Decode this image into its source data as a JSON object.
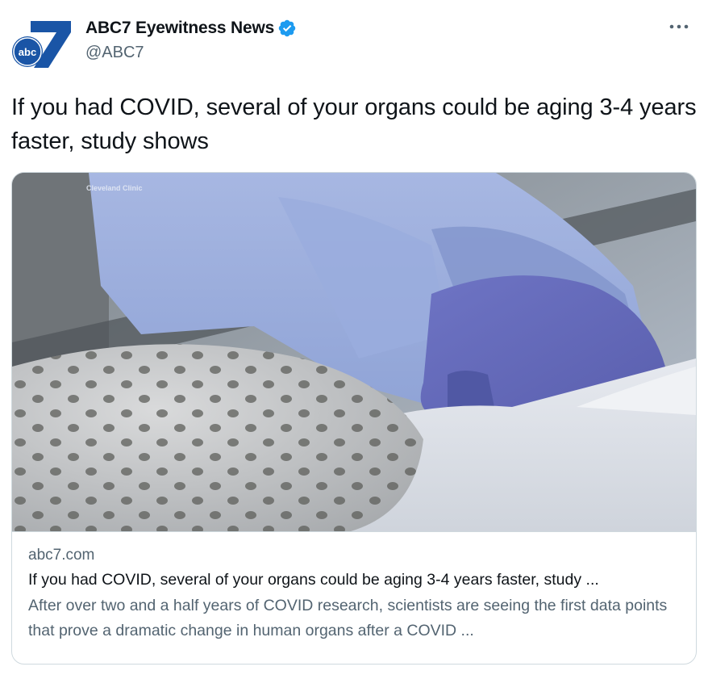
{
  "account": {
    "display_name": "ABC7 Eyewitness News",
    "handle": "@ABC7",
    "verified": true,
    "logo_text": "abc",
    "logo_number": "7"
  },
  "tweet": {
    "text": "If you had COVID, several of your organs could be aging 3-4 years faster, study shows"
  },
  "card": {
    "image_watermark": "Cleveland Clinic",
    "domain": "abc7.com",
    "title": "If you had COVID, several of your organs could be aging 3-4 years faster, study ...",
    "description": "After over two and a half years of COVID research, scientists are seeing the first data points that prove a dramatic change in human organs after a COVID ..."
  },
  "icons": {
    "more": "more-horizontal-icon",
    "verified": "verified-badge-icon"
  },
  "colors": {
    "verified_blue": "#1d9bf0",
    "secondary_text": "#536471",
    "primary_text": "#0f1419",
    "logo_blue": "#1a55a6"
  }
}
